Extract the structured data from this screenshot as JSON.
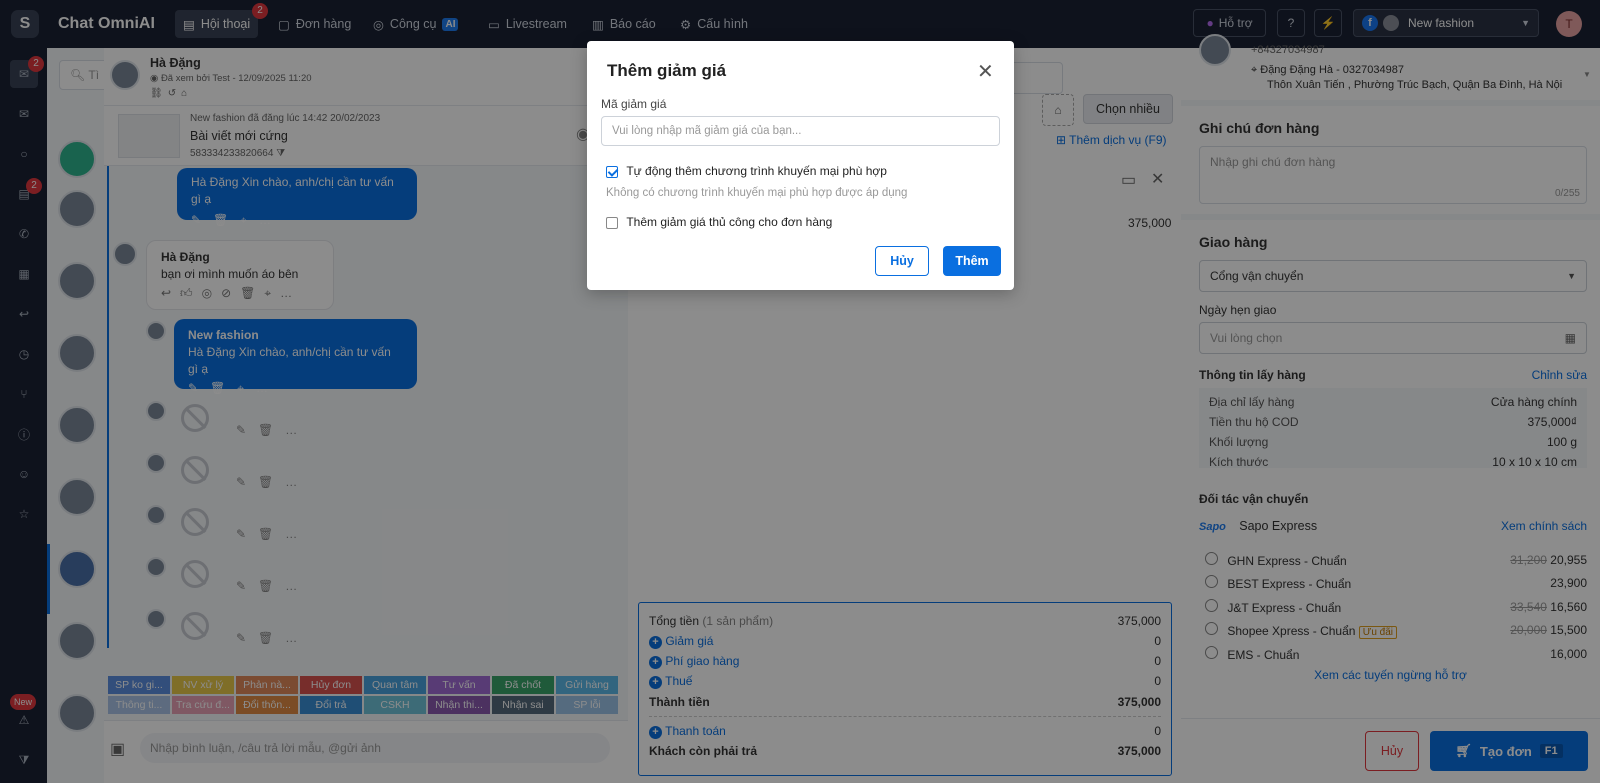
{
  "topbar": {
    "app_title": "Chat OmniAI",
    "nav": [
      {
        "label": "Hội thoại",
        "badge": "2"
      },
      {
        "label": "Đơn hàng"
      },
      {
        "label": "Công cụ",
        "chip": "AI"
      },
      {
        "label": "Livestream"
      },
      {
        "label": "Báo cáo"
      },
      {
        "label": "Cấu hình"
      }
    ],
    "support": "Hỗ trợ",
    "page_name": "New fashion",
    "user_initial": "T"
  },
  "sidebar": {
    "inbox_badge": "2",
    "chat_badge": "2",
    "new_badge": "New"
  },
  "chat": {
    "search_placeholder": "Tì",
    "contact_name": "Hà Đặng",
    "seen_text": "Đã xem bởi Test - 12/09/2025 11:20",
    "post": {
      "meta": "New fashion đã đăng lúc 14:42 20/02/2023",
      "title": "Bài viết mới cứng",
      "id": "583334233820664"
    },
    "messages": [
      {
        "text": "Hà Đặng Xin chào, anh/chị cần tư vấn gì ạ"
      },
      {
        "sender": "Hà Đặng",
        "text": "bạn ơi mình muốn áo bên"
      },
      {
        "sender": "New fashion",
        "text": "Hà Đặng Xin chào, anh/chị cần tư vấn gì ạ"
      }
    ],
    "tags_row1": [
      "SP ko gi...",
      "NV xử lý",
      "Phản nà...",
      "Hủy đơn",
      "Quan tâm",
      "Tư vấn",
      "Đã chốt",
      "Gửi hàng"
    ],
    "tags_row2": [
      "Thông ti...",
      "Tra cứu đ...",
      "Đổi thôn...",
      "Đổi trả",
      "CSKH",
      "Nhận thi...",
      "Nhận sai",
      "SP lỗi"
    ],
    "input_placeholder": "Nhập bình luận, /câu trả lời mẫu, @gửi ảnh"
  },
  "order": {
    "choose_many": "Chọn nhiều",
    "add_service": "Thêm dịch vụ (F9)",
    "line_price": "375,000",
    "summary": {
      "total_label": "Tổng tiền",
      "total_count": "(1 sản phẩm)",
      "total": "375,000",
      "discount": "Giảm giá",
      "discount_val": "0",
      "shipping": "Phí giao hàng",
      "shipping_val": "0",
      "tax": "Thuế",
      "tax_val": "0",
      "subtotal_label": "Thành tiền",
      "subtotal": "375,000",
      "payment": "Thanh toán",
      "payment_val": "0",
      "due_label": "Khách còn phải trả",
      "due": "375,000"
    }
  },
  "right": {
    "phone": "+84327034987",
    "address_name": "Đặng Đặng Hà - 0327034987",
    "address": "Thôn Xuân Tiến , Phường Trúc Bạch, Quận Ba Đình, Hà Nội",
    "note_title": "Ghi chú đơn hàng",
    "note_placeholder": "Nhập ghi chú đơn hàng",
    "note_count": "0/255",
    "delivery_title": "Giao hàng",
    "carrier_select": "Cổng vận chuyển",
    "date_label": "Ngày hẹn giao",
    "date_placeholder": "Vui lòng chọn",
    "pickup_title": "Thông tin lấy hàng",
    "edit": "Chỉnh sửa",
    "pickup": [
      {
        "k": "Địa chỉ lấy hàng",
        "v": "Cửa hàng chính"
      },
      {
        "k": "Tiền thu hộ COD",
        "v": "375,000₫"
      },
      {
        "k": "Khối lượng",
        "v": "100 g"
      },
      {
        "k": "Kích thước",
        "v": "10 x 10 x 10 cm"
      }
    ],
    "partner_title": "Đối tác vận chuyển",
    "partner_logo": "Sapo",
    "partner_name": "Sapo Express",
    "policy": "Xem chính sách",
    "carriers": [
      {
        "name": "GHN Express - Chuẩn",
        "old": "31,200",
        "price": "20,955"
      },
      {
        "name": "BEST Express - Chuẩn",
        "old": "",
        "price": "23,900"
      },
      {
        "name": "J&T Express - Chuẩn",
        "old": "33,540",
        "price": "16,560"
      },
      {
        "name": "Shopee Xpress - Chuẩn",
        "tag": "Ưu đãi",
        "old": "20,000",
        "price": "15,500"
      },
      {
        "name": "EMS - Chuẩn",
        "old": "",
        "price": "16,000"
      }
    ],
    "more_routes": "Xem các tuyến ngừng hỗ trợ",
    "cancel": "Hủy",
    "create": "Tạo đơn",
    "create_key": "F1"
  },
  "modal": {
    "title": "Thêm giảm giá",
    "code_label": "Mã giảm giá",
    "code_placeholder": "Vui lòng nhập mã giảm giá của bạn...",
    "auto_label": "Tự động thêm chương trình khuyến mại phù hợp",
    "auto_note": "Không có chương trình khuyến mại phù hợp được áp dụng",
    "manual_label": "Thêm giảm giá thủ công cho đơn hàng",
    "cancel": "Hủy",
    "add": "Thêm"
  }
}
